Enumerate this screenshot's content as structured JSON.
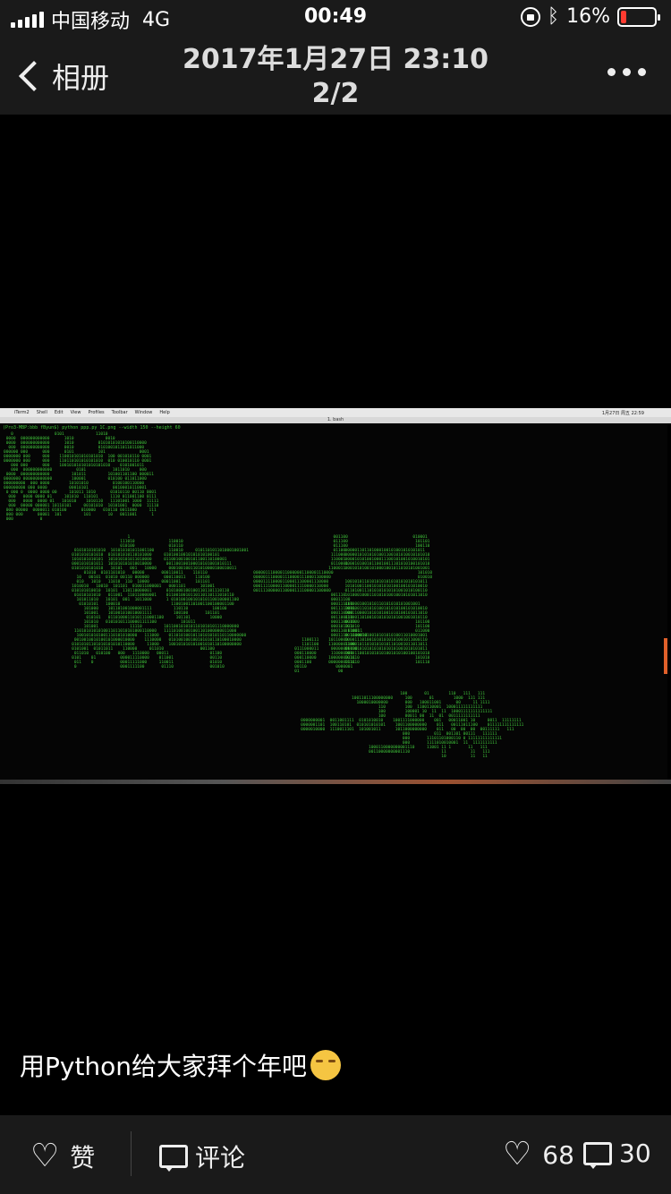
{
  "status_bar": {
    "carrier": "中国移动",
    "network": "4G",
    "time": "00:49",
    "battery_percent": "16%",
    "battery_level": 0.16,
    "icons": [
      "signal-icon",
      "orientation-lock-icon",
      "bluetooth-icon",
      "battery-icon"
    ]
  },
  "nav": {
    "back_label": "相册",
    "title_line1": "2017年1月27日 23:10",
    "title_line2": "2/2",
    "more_icon": "more-dots-icon"
  },
  "photo": {
    "mac_menu": [
      "iTerm2",
      "Shell",
      "Edit",
      "View",
      "Profiles",
      "Toolbar",
      "Window",
      "Help"
    ],
    "mac_menu_right": "1月27日 周五 22:59",
    "window_title": "1. bash",
    "command": "(Pro3-MBP:bbb fByun$) python ppp.py 1C.png --width 150 --height 60"
  },
  "caption": {
    "text": "用Python给大家拜个年吧",
    "emoji": "smiling-face-emoji"
  },
  "bottom_bar": {
    "like_label": "赞",
    "comment_label": "评论",
    "like_count": "68",
    "comment_count": "30"
  }
}
